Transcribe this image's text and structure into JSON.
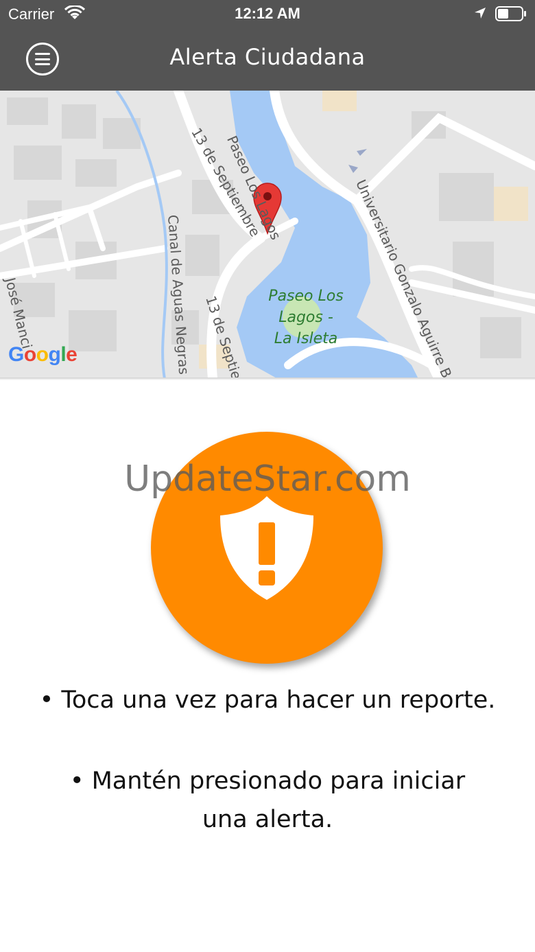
{
  "status_bar": {
    "carrier": "Carrier",
    "time": "12:12 AM",
    "icons": [
      "wifi-icon",
      "location-arrow-icon",
      "battery-icon"
    ]
  },
  "nav": {
    "title": "Alerta Ciudadana",
    "menu_icon": "hamburger-menu-icon"
  },
  "map": {
    "labels": {
      "paseo_los_lagos": "Paseo Los Lagos",
      "trece_de_septiembre_1": "13 de Septiembre",
      "trece_de_septiembre_2": "13 de Septie",
      "canal": "Canal de Aguas Negras",
      "jose": "José Manci",
      "universitario": "Universitario Gonzalo Aguirre B",
      "park": "Paseo Los Lagos - La Isleta",
      "park_line1": "Paseo Los",
      "park_line2": "Lagos -",
      "park_line3": "La Isleta"
    },
    "logo": "Google",
    "marker_icon": "map-pin-icon"
  },
  "watermark": "UpdateStar.com",
  "alert": {
    "icon": "shield-exclamation-icon",
    "color": "#ff8a00"
  },
  "instructions": {
    "line1": "• Toca una vez para hacer un reporte.",
    "line2": "• Mantén presionado para iniciar una alerta."
  },
  "colors": {
    "nav_bg": "#545454",
    "water": "#a4c9f5",
    "park": "#c8e6b4"
  }
}
